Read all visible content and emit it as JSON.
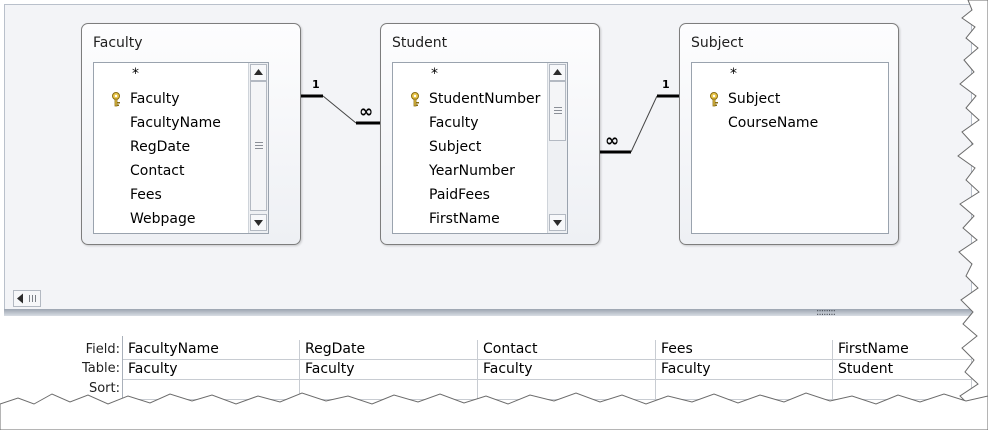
{
  "tables": [
    {
      "title": "Faculty",
      "fields": [
        "*",
        "Faculty",
        "FacultyName",
        "RegDate",
        "Contact",
        "Fees",
        "Webpage"
      ],
      "key_field_index": 1,
      "has_scrollbar": true
    },
    {
      "title": "Student",
      "fields": [
        "*",
        "StudentNumber",
        "Faculty",
        "Subject",
        "YearNumber",
        "PaidFees",
        "FirstName"
      ],
      "key_field_index": 1,
      "has_scrollbar": true
    },
    {
      "title": "Subject",
      "fields": [
        "*",
        "Subject",
        "CourseName"
      ],
      "key_field_index": 1,
      "has_scrollbar": false
    }
  ],
  "relationships": [
    {
      "from": "Faculty",
      "to": "Student",
      "one_label": "1",
      "many_label": "∞"
    },
    {
      "from": "Subject",
      "to": "Student",
      "one_label": "1",
      "many_label": "∞"
    }
  ],
  "query_grid": {
    "row_labels": {
      "field": "Field:",
      "table": "Table:",
      "sort": "Sort:"
    },
    "columns": [
      {
        "field": "FacultyName",
        "table": "Faculty"
      },
      {
        "field": "RegDate",
        "table": "Faculty"
      },
      {
        "field": "Contact",
        "table": "Faculty"
      },
      {
        "field": "Fees",
        "table": "Faculty"
      },
      {
        "field": "FirstName",
        "table": "Student"
      }
    ]
  },
  "icons": {
    "primary_key": "key-icon",
    "scroll_up": "arrow-up-icon",
    "scroll_down": "arrow-down-icon",
    "scroll_left": "arrow-left-icon"
  },
  "colors": {
    "design_background": "#f3f4f7",
    "table_border": "#7d7d7d",
    "splitter": "#9ba4b0"
  }
}
